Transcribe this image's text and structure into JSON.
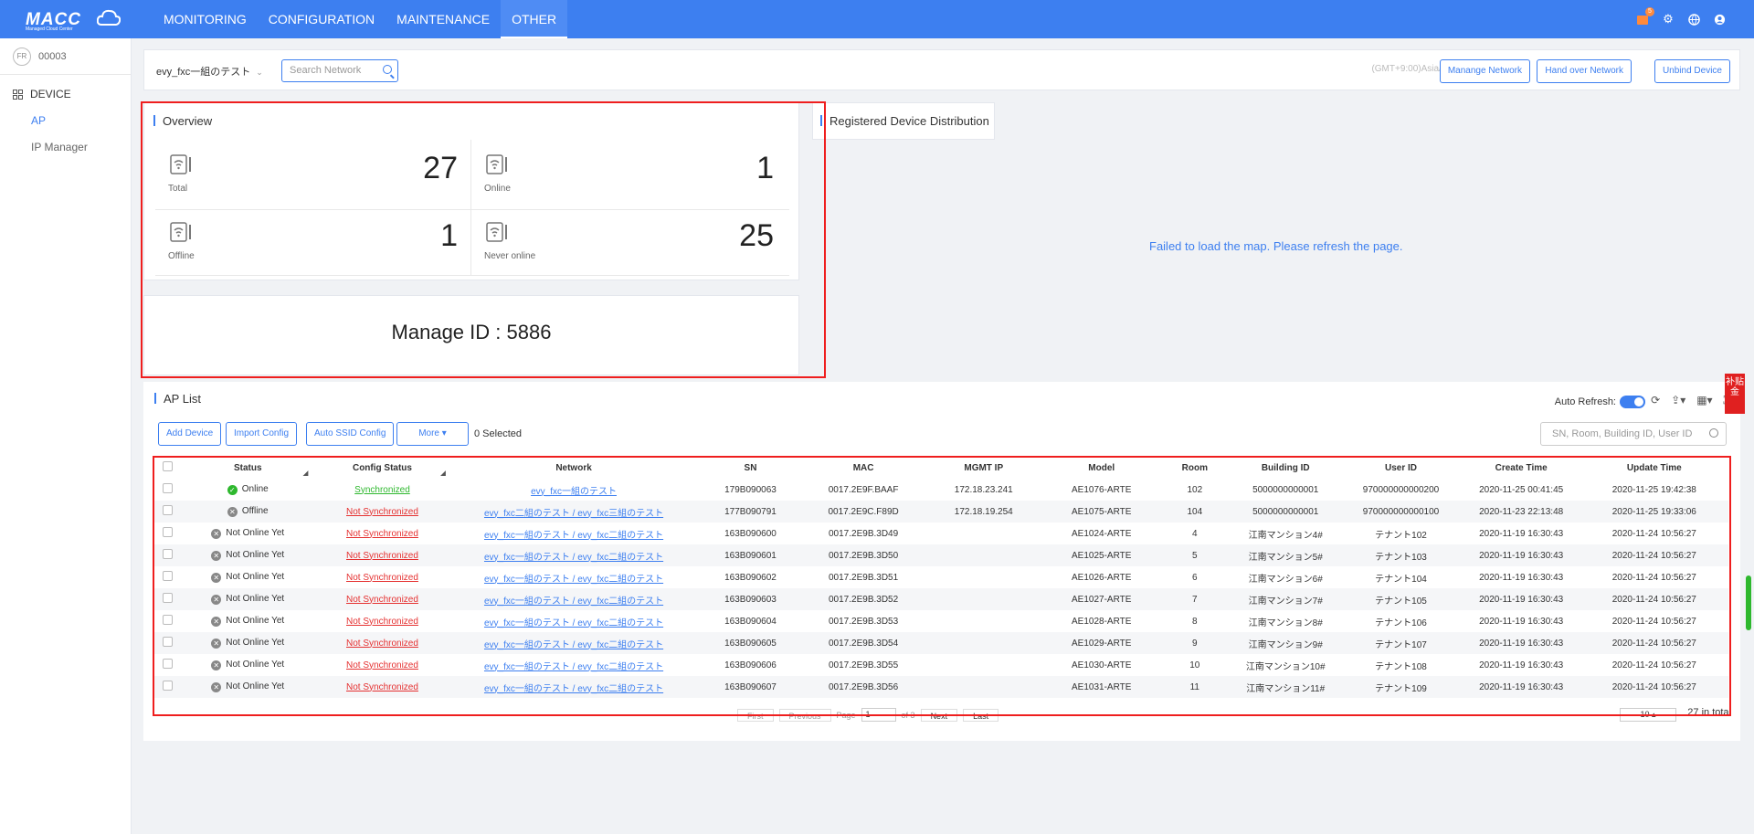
{
  "brand": {
    "name": "MACC",
    "subtitle": "Managed Cloud Center"
  },
  "nav": [
    "MONITORING",
    "CONFIGURATION",
    "MAINTENANCE",
    "OTHER"
  ],
  "nav_active": "OTHER",
  "notifications_count": "5",
  "user": {
    "id": "00003",
    "avatar_text": "FR"
  },
  "sidebar": {
    "section": "DEVICE",
    "items": [
      "AP",
      "IP Manager"
    ],
    "active": "AP"
  },
  "filter": {
    "network": "evy_fxc一組のテスト",
    "search_placeholder": "Search Network",
    "timezone": "(GMT+9:00)Asia/Tokyo",
    "buttons": [
      "Manange Network",
      "Hand over Network",
      "Unbind Device"
    ]
  },
  "overview": {
    "title": "Overview",
    "stats": [
      {
        "label": "Total",
        "value": "27"
      },
      {
        "label": "Online",
        "value": "1"
      },
      {
        "label": "Offline",
        "value": "1"
      },
      {
        "label": "Never online",
        "value": "25"
      }
    ],
    "manage_id_label": "Manage ID  :",
    "manage_id": "5886"
  },
  "distribution": {
    "title": "Registered Device Distribution",
    "map_error": "Failed to load the map. Please refresh the page."
  },
  "ap_list": {
    "title": "AP List",
    "buttons": [
      "Add Device",
      "Import Config",
      "Auto SSID Config",
      "More"
    ],
    "selected": "0 Selected",
    "auto_refresh_label": "Auto Refresh:",
    "search_placeholder": "SN, Room, Building ID, User ID",
    "columns": [
      "Status",
      "Config Status",
      "Network",
      "SN",
      "MAC",
      "MGMT IP",
      "Model",
      "Room",
      "Building ID",
      "User ID",
      "Create Time",
      "Update Time"
    ],
    "rows": [
      [
        "Online",
        "Synchronized",
        "evy_fxc一組のテスト",
        "179B090063",
        "0017.2E9F.BAAF",
        "172.18.23.241",
        "AE1076-ARTE",
        "102",
        "5000000000001",
        "970000000000200",
        "2020-11-25 00:41:45",
        "2020-11-25 19:42:38"
      ],
      [
        "Offline",
        "Not Synchronized",
        "evy_fxc二組のテスト / evy_fxc三組のテスト",
        "177B090791",
        "0017.2E9C.F89D",
        "172.18.19.254",
        "AE1075-ARTE",
        "104",
        "5000000000001",
        "970000000000100",
        "2020-11-23 22:13:48",
        "2020-11-25 19:33:06"
      ],
      [
        "Not Online Yet",
        "Not Synchronized",
        "evy_fxc一組のテスト / evy_fxc二組のテスト",
        "163B090600",
        "0017.2E9B.3D49",
        "",
        "AE1024-ARTE",
        "4",
        "江南マンション4#",
        "テナント102",
        "2020-11-19 16:30:43",
        "2020-11-24 10:56:27"
      ],
      [
        "Not Online Yet",
        "Not Synchronized",
        "evy_fxc一組のテスト / evy_fxc二組のテスト",
        "163B090601",
        "0017.2E9B.3D50",
        "",
        "AE1025-ARTE",
        "5",
        "江南マンション5#",
        "テナント103",
        "2020-11-19 16:30:43",
        "2020-11-24 10:56:27"
      ],
      [
        "Not Online Yet",
        "Not Synchronized",
        "evy_fxc一組のテスト / evy_fxc二組のテスト",
        "163B090602",
        "0017.2E9B.3D51",
        "",
        "AE1026-ARTE",
        "6",
        "江南マンション6#",
        "テナント104",
        "2020-11-19 16:30:43",
        "2020-11-24 10:56:27"
      ],
      [
        "Not Online Yet",
        "Not Synchronized",
        "evy_fxc一組のテスト / evy_fxc二組のテスト",
        "163B090603",
        "0017.2E9B.3D52",
        "",
        "AE1027-ARTE",
        "7",
        "江南マンション7#",
        "テナント105",
        "2020-11-19 16:30:43",
        "2020-11-24 10:56:27"
      ],
      [
        "Not Online Yet",
        "Not Synchronized",
        "evy_fxc一組のテスト / evy_fxc二組のテスト",
        "163B090604",
        "0017.2E9B.3D53",
        "",
        "AE1028-ARTE",
        "8",
        "江南マンション8#",
        "テナント106",
        "2020-11-19 16:30:43",
        "2020-11-24 10:56:27"
      ],
      [
        "Not Online Yet",
        "Not Synchronized",
        "evy_fxc一組のテスト / evy_fxc二組のテスト",
        "163B090605",
        "0017.2E9B.3D54",
        "",
        "AE1029-ARTE",
        "9",
        "江南マンション9#",
        "テナント107",
        "2020-11-19 16:30:43",
        "2020-11-24 10:56:27"
      ],
      [
        "Not Online Yet",
        "Not Synchronized",
        "evy_fxc一組のテスト / evy_fxc二組のテスト",
        "163B090606",
        "0017.2E9B.3D55",
        "",
        "AE1030-ARTE",
        "10",
        "江南マンション10#",
        "テナント108",
        "2020-11-19 16:30:43",
        "2020-11-24 10:56:27"
      ],
      [
        "Not Online Yet",
        "Not Synchronized",
        "evy_fxc一組のテスト / evy_fxc二組のテスト",
        "163B090607",
        "0017.2E9B.3D56",
        "",
        "AE1031-ARTE",
        "11",
        "江南マンション11#",
        "テナント109",
        "2020-11-19 16:30:43",
        "2020-11-24 10:56:27"
      ]
    ],
    "pagination": {
      "first": "First",
      "previous": "Previous",
      "page_label": "Page",
      "page": "1",
      "of": "of 3",
      "next": "Next",
      "last": "Last",
      "page_size": "10",
      "total": "27 in total"
    }
  },
  "side_tab": "补贴金",
  "colors": {
    "primary": "#3d7ff0",
    "online": "#2eb82e",
    "error": "#e53030",
    "highlight": "#ef1e1e"
  }
}
